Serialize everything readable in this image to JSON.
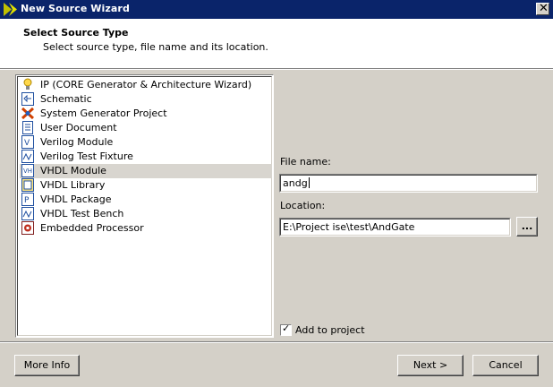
{
  "window": {
    "title": "New Source Wizard",
    "close_glyph": "✕"
  },
  "header": {
    "title": "Select Source Type",
    "subtitle": "Select source type, file name and its location."
  },
  "source_types": [
    {
      "label": "IP (CORE Generator & Architecture Wizard)",
      "icon": "ip-core-icon",
      "selected": false
    },
    {
      "label": "Schematic",
      "icon": "schematic-icon",
      "selected": false
    },
    {
      "label": "System Generator Project",
      "icon": "system-generator-icon",
      "selected": false
    },
    {
      "label": "User Document",
      "icon": "document-icon",
      "selected": false
    },
    {
      "label": "Verilog Module",
      "icon": "verilog-icon",
      "selected": false
    },
    {
      "label": "Verilog Test Fixture",
      "icon": "verilog-test-icon",
      "selected": false
    },
    {
      "label": "VHDL Module",
      "icon": "vhdl-module-icon",
      "selected": true
    },
    {
      "label": "VHDL Library",
      "icon": "vhdl-library-icon",
      "selected": false
    },
    {
      "label": "VHDL Package",
      "icon": "vhdl-package-icon",
      "selected": false
    },
    {
      "label": "VHDL Test Bench",
      "icon": "vhdl-testbench-icon",
      "selected": false
    },
    {
      "label": "Embedded Processor",
      "icon": "embedded-processor-icon",
      "selected": false
    }
  ],
  "form": {
    "file_name_label": "File name:",
    "file_name_value": "andg",
    "location_label": "Location:",
    "location_value": "E:\\Project ise\\test\\AndGate",
    "browse_label": "...",
    "add_to_project_label": "Add to project",
    "add_to_project_checked": true,
    "check_glyph": "✓"
  },
  "buttons": {
    "more_info": "More Info",
    "next": "Next >",
    "cancel": "Cancel"
  }
}
